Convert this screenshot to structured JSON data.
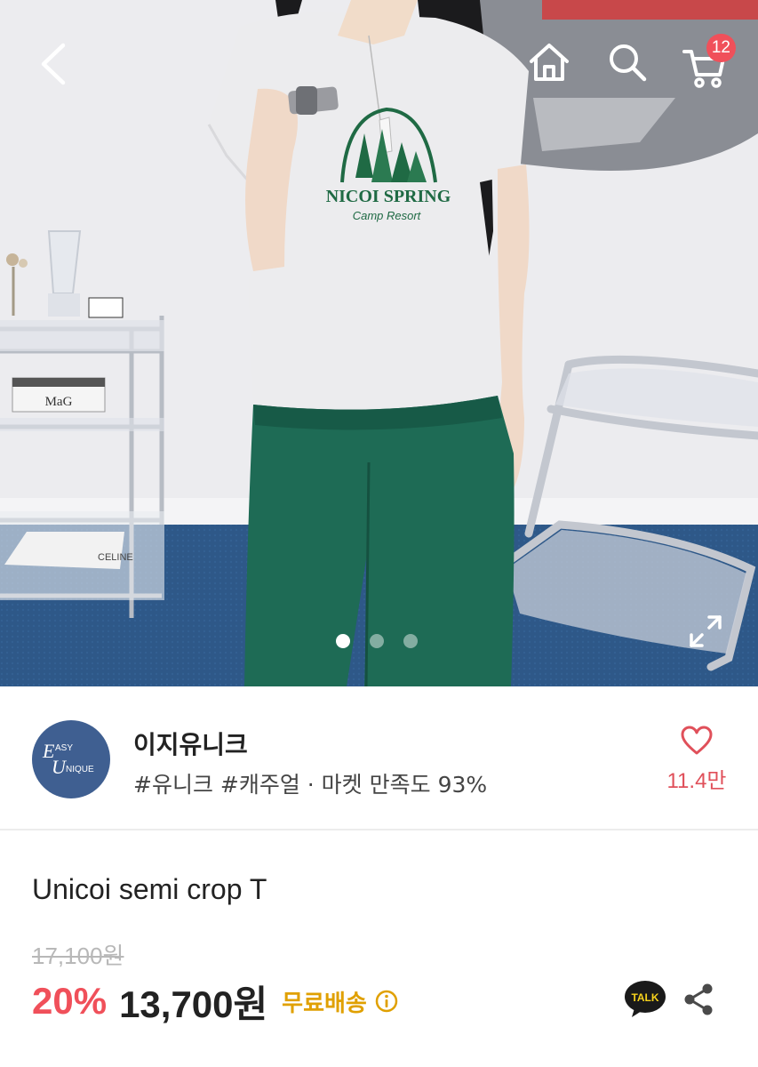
{
  "header": {
    "back_icon": "chevron-left-icon",
    "home_icon": "home-icon",
    "search_icon": "search-icon",
    "cart_icon": "cart-icon",
    "cart_badge": "12"
  },
  "hero": {
    "shirt_print_line1": "NICOI SPRING",
    "shirt_print_line2": "Camp Resort",
    "book_label": "MaG",
    "magazine_label": "CELINE",
    "carousel_count": 3,
    "carousel_active": 0,
    "expand_icon": "expand-icon"
  },
  "shop": {
    "logo_line1": "ASY",
    "logo_line2": "NIQUE",
    "logo_initial1": "E",
    "logo_initial2": "U",
    "name": "이지유니크",
    "tags": "#유니크 #캐주얼 · 마켓 만족도 93%",
    "favorite_count": "11.4만"
  },
  "product": {
    "name": "Unicoi semi crop T",
    "original_price": "17,100원",
    "discount": "20%",
    "price": "13,700원",
    "shipping": "무료배송",
    "talk_label": "TALK"
  },
  "colors": {
    "accent_red": "#f0505a",
    "shipping_gold": "#e0a000",
    "logo_blue": "#3f5f91"
  }
}
